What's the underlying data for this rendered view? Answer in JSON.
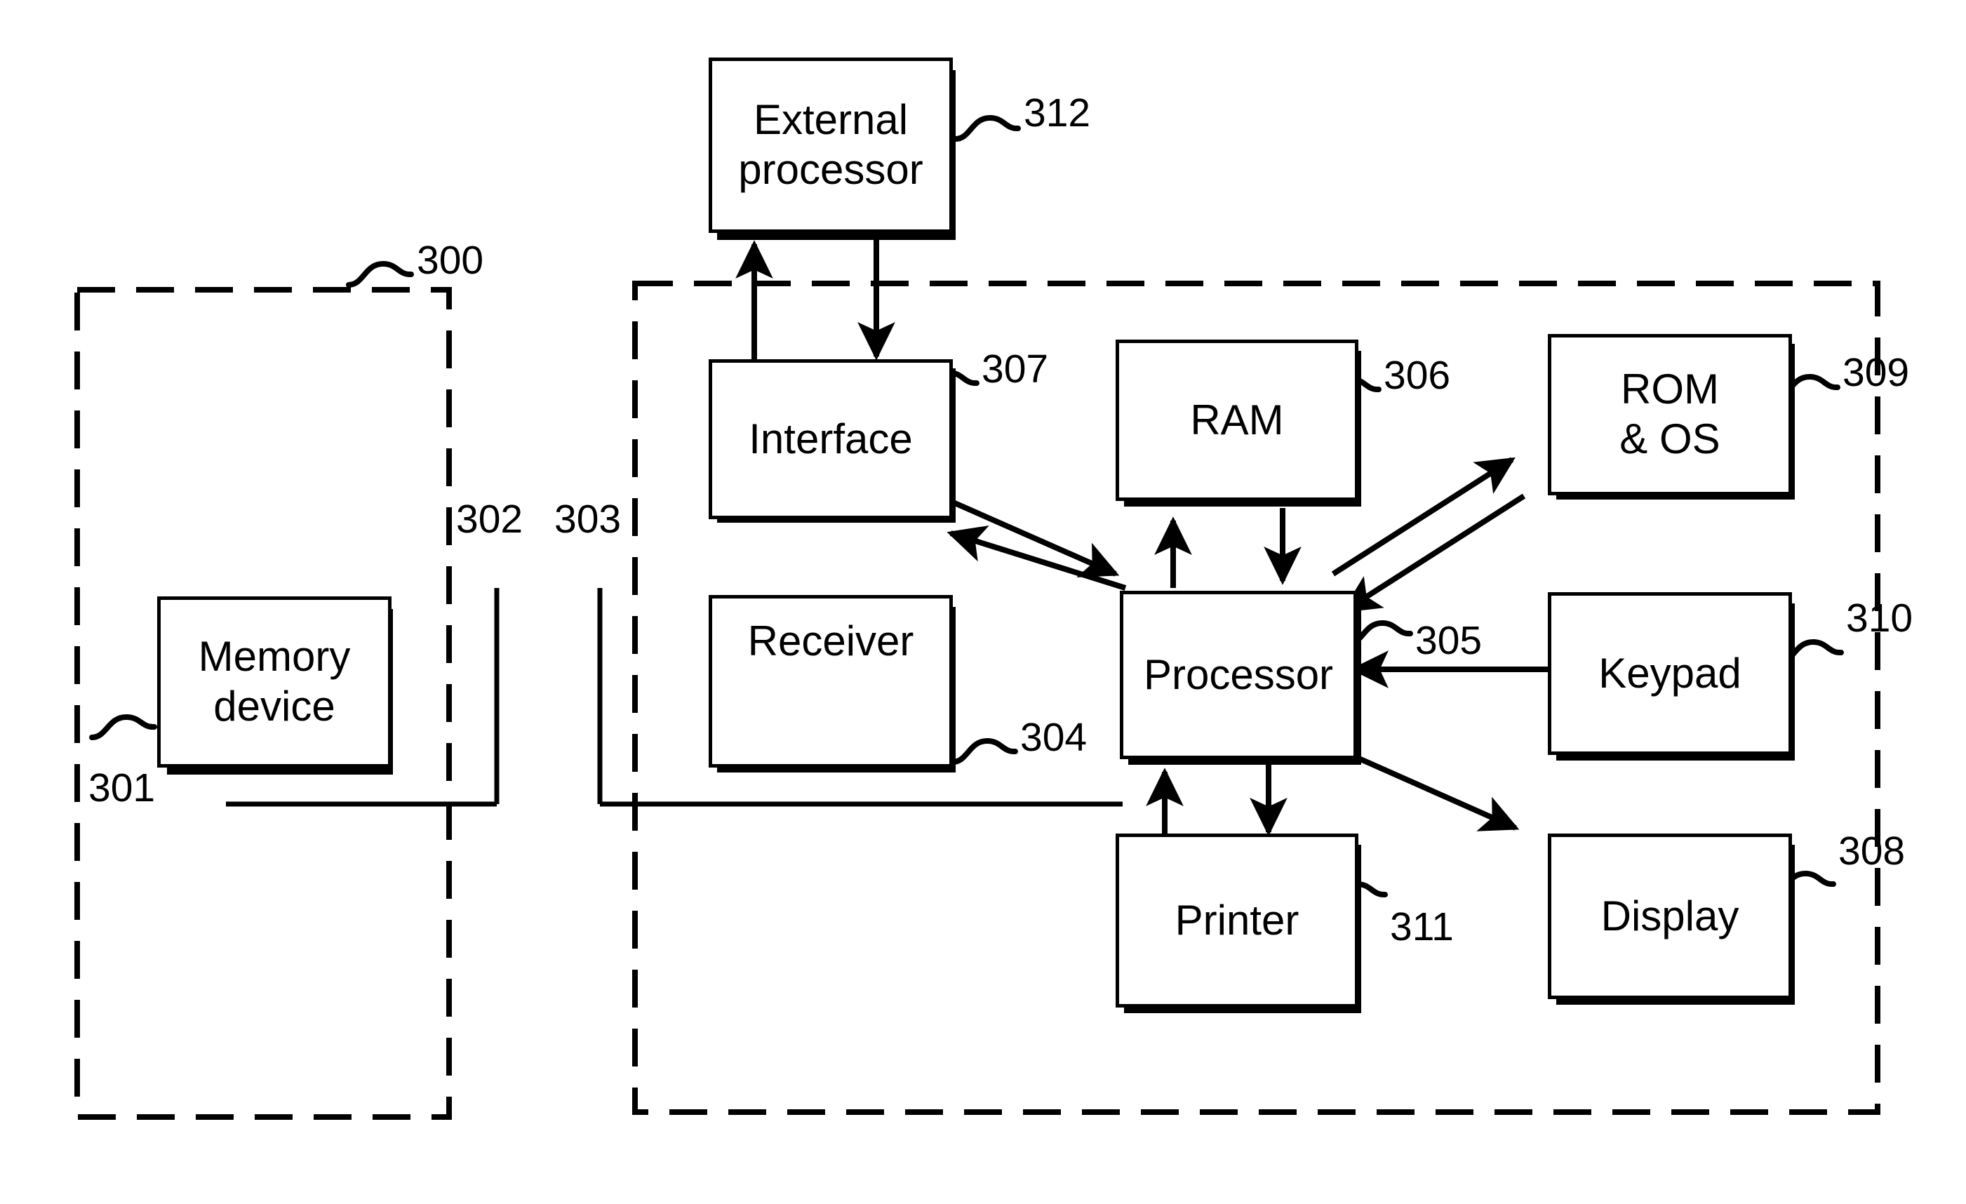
{
  "figure": {
    "kind": "patent-block-diagram",
    "line_color": "#000000",
    "background": "#ffffff"
  },
  "enclosures": [
    {
      "id": "300",
      "name": "right-system-boundary",
      "numeral": "300",
      "style": "dashed"
    },
    {
      "id": "301",
      "name": "left-memory-boundary",
      "numeral": "301",
      "style": "dashed"
    }
  ],
  "blocks": [
    {
      "id": "312",
      "name": "external-processor",
      "label": "External\nprocessor",
      "line1": "External",
      "line2": "processor",
      "numeral": "312"
    },
    {
      "id": "307",
      "name": "interface",
      "label": "Interface",
      "line1": "Interface",
      "line2": "",
      "numeral": "307"
    },
    {
      "id": "306",
      "name": "ram",
      "label": "RAM",
      "line1": "RAM",
      "line2": "",
      "numeral": "306"
    },
    {
      "id": "309",
      "name": "rom-and-os",
      "label": "ROM\n& OS",
      "line1": "ROM",
      "line2": "& OS",
      "numeral": "309"
    },
    {
      "id": "304",
      "name": "receiver",
      "label": "Receiver",
      "line1": "Receiver",
      "line2": "",
      "numeral": "304"
    },
    {
      "id": "305",
      "name": "processor",
      "label": "Processor",
      "line1": "Processor",
      "line2": "",
      "numeral": "305"
    },
    {
      "id": "310",
      "name": "keypad",
      "label": "Keypad",
      "line1": "Keypad",
      "line2": "",
      "numeral": "310"
    },
    {
      "id": "311",
      "name": "printer",
      "label": "Printer",
      "line1": "Printer",
      "line2": "",
      "numeral": "311"
    },
    {
      "id": "308",
      "name": "display",
      "label": "Display",
      "line1": "Display",
      "line2": "",
      "numeral": "308"
    },
    {
      "id": "301b",
      "name": "memory-device",
      "label": "Memory\ndevice",
      "line1": "Memory",
      "line2": "device",
      "numeral": "301"
    }
  ],
  "connector_numerals": [
    {
      "id": "302",
      "name": "memory-bus-lead",
      "numeral": "302"
    },
    {
      "id": "303",
      "name": "receiver-bus-lead",
      "numeral": "303"
    }
  ],
  "connections": [
    {
      "from": "interface",
      "to": "external-processor",
      "type": "arrow-up"
    },
    {
      "from": "external-processor",
      "to": "interface",
      "type": "arrow-down"
    },
    {
      "from": "interface",
      "to": "processor",
      "type": "arrow-diagonal"
    },
    {
      "from": "processor",
      "to": "interface",
      "type": "arrow-diagonal"
    },
    {
      "from": "processor",
      "to": "ram",
      "type": "arrow-up"
    },
    {
      "from": "ram",
      "to": "processor",
      "type": "arrow-down"
    },
    {
      "from": "processor",
      "to": "rom-and-os",
      "type": "arrow-diagonal"
    },
    {
      "from": "rom-and-os",
      "to": "processor",
      "type": "arrow-diagonal"
    },
    {
      "from": "keypad",
      "to": "processor",
      "type": "arrow-left"
    },
    {
      "from": "processor",
      "to": "display",
      "type": "arrow-diagonal"
    },
    {
      "from": "printer",
      "to": "processor",
      "type": "arrow-up"
    },
    {
      "from": "processor",
      "to": "printer",
      "type": "arrow-down"
    },
    {
      "from": "memory-device",
      "to": "receiver",
      "type": "plain-line"
    }
  ]
}
